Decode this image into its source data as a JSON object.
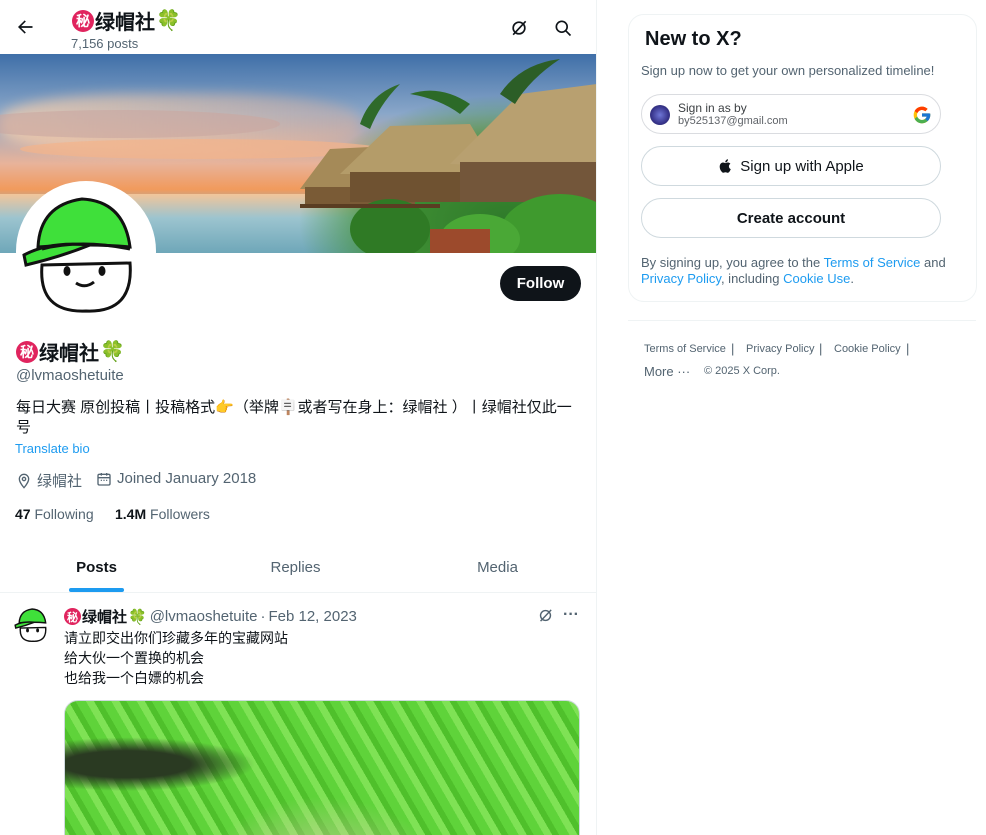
{
  "header": {
    "name": "绿帽社",
    "secret_char": "秘",
    "clover": "🍀",
    "post_count": "7,156 posts"
  },
  "profile": {
    "name": "绿帽社",
    "handle": "@lvmaoshetuite",
    "bio_line1": "每日大赛 原创投稿丨投稿格式👉（举牌🪧或者写在身上：绿帽社 ）丨绿帽社仅此一",
    "bio_line2": "号",
    "translate_bio": "Translate bio",
    "location": "绿帽社",
    "joined": "Joined January 2018",
    "following_count": "47",
    "following_label": "Following",
    "followers_count": "1.4M",
    "followers_label": "Followers",
    "follow_button": "Follow"
  },
  "tabs": [
    {
      "label": "Posts",
      "active": true
    },
    {
      "label": "Replies",
      "active": false
    },
    {
      "label": "Media",
      "active": false
    }
  ],
  "tweet": {
    "name": "绿帽社",
    "handle": "@lvmaoshetuite",
    "separator": "·",
    "date": "Feb 12, 2023",
    "more": "···",
    "lines": [
      "请立即交出你们珍藏多年的宝藏网站",
      "给大伙一个置换的机会",
      "也给我一个白嫖的机会"
    ]
  },
  "sidebar": {
    "title": "New to X?",
    "subtitle": "Sign up now to get your own personalized timeline!",
    "google_signin_line1": "Sign in as by",
    "google_signin_line2": "by525137@gmail.com",
    "apple_button": "Sign up with Apple",
    "create_account": "Create account",
    "legal_prefix": "By signing up, you agree to the ",
    "terms_link": "Terms of Service",
    "legal_and": " and ",
    "privacy_link": "Privacy Policy",
    "legal_including": ", including ",
    "cookie_link": "Cookie Use",
    "legal_end": ".",
    "footer": {
      "terms": "Terms of Service",
      "privacy": "Privacy Policy",
      "cookie": "Cookie Policy",
      "more": "More ···",
      "copyright": "© 2025 X Corp.",
      "separator": "|"
    }
  },
  "colors": {
    "accent": "#1d9bf0",
    "text": "#0f1419",
    "muted": "#536471",
    "hat_green": "#3fe03a"
  }
}
